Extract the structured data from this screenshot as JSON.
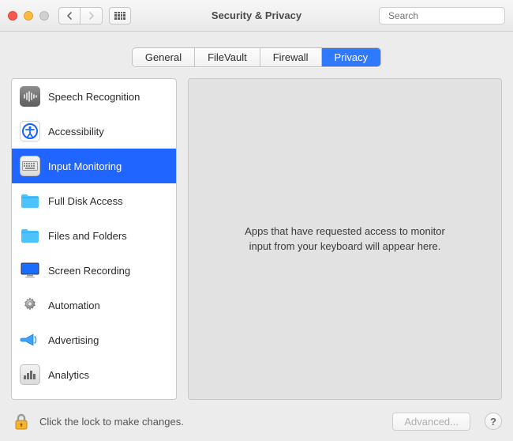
{
  "window": {
    "title": "Security & Privacy"
  },
  "search": {
    "placeholder": "Search"
  },
  "tabs": [
    {
      "label": "General",
      "active": false
    },
    {
      "label": "FileVault",
      "active": false
    },
    {
      "label": "Firewall",
      "active": false
    },
    {
      "label": "Privacy",
      "active": true
    }
  ],
  "sidebar": {
    "items": [
      {
        "label": "Speech Recognition",
        "icon": "waveform-icon",
        "selected": false
      },
      {
        "label": "Accessibility",
        "icon": "accessibility-icon",
        "selected": false
      },
      {
        "label": "Input Monitoring",
        "icon": "keyboard-icon",
        "selected": true
      },
      {
        "label": "Full Disk Access",
        "icon": "folder-icon",
        "selected": false
      },
      {
        "label": "Files and Folders",
        "icon": "folder-icon",
        "selected": false
      },
      {
        "label": "Screen Recording",
        "icon": "display-icon",
        "selected": false
      },
      {
        "label": "Automation",
        "icon": "gear-icon",
        "selected": false
      },
      {
        "label": "Advertising",
        "icon": "megaphone-icon",
        "selected": false
      },
      {
        "label": "Analytics",
        "icon": "chart-icon",
        "selected": false
      }
    ]
  },
  "content": {
    "message": "Apps that have requested access to monitor input from your keyboard will appear here."
  },
  "footer": {
    "lock_label": "Click the lock to make changes.",
    "advanced_label": "Advanced...",
    "help_label": "?"
  }
}
